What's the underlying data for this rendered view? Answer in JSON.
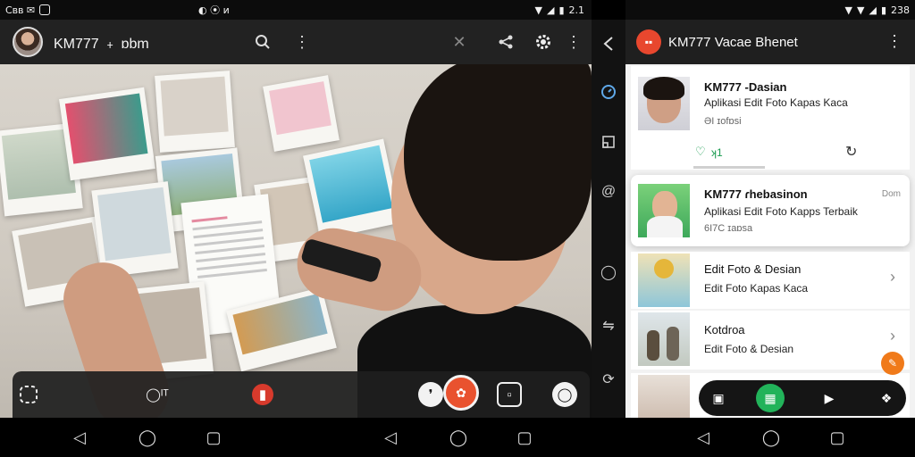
{
  "status_left": {
    "icons_left": [
      "sim-icon",
      "signal-icon",
      "wifi-icon",
      "mail-icon",
      "notification-icon"
    ],
    "left_text": "Cʙʙ ✉",
    "mid_text": "◐ ⦿ ᴎ",
    "right_text": "2.1"
  },
  "status_right": {
    "time": "238"
  },
  "camera": {
    "title": "KM777 ﹢ ɒbm",
    "colors": {
      "shutter": "#e9522f",
      "record": "#d73a2c"
    }
  },
  "gallery": {
    "title": "KM777 Vacae Bhenet",
    "items": [
      {
        "title": "KM777 -Dasian",
        "subtitle": "Aplikasi Edit Foto Kapas Kaca",
        "meta": "ƏI ɪofɒsi",
        "action_count": "ʞ1"
      },
      {
        "title": "KM777 ɾhebasinon",
        "subtitle": "Aplikasi Edit Foto Kapps Terbaik",
        "meta": "6I7C ɪaɒsa",
        "tag": "Dom"
      },
      {
        "title": "Edit Foto & Desian",
        "subtitle": "Edit Foto Kapas Kaca"
      },
      {
        "title": "Kotdroa",
        "subtitle": "Edit Foto & Desian"
      }
    ],
    "colors": {
      "accent": "#e8472e",
      "fab": "#f07a1a",
      "dock_active": "#22b35a"
    }
  }
}
